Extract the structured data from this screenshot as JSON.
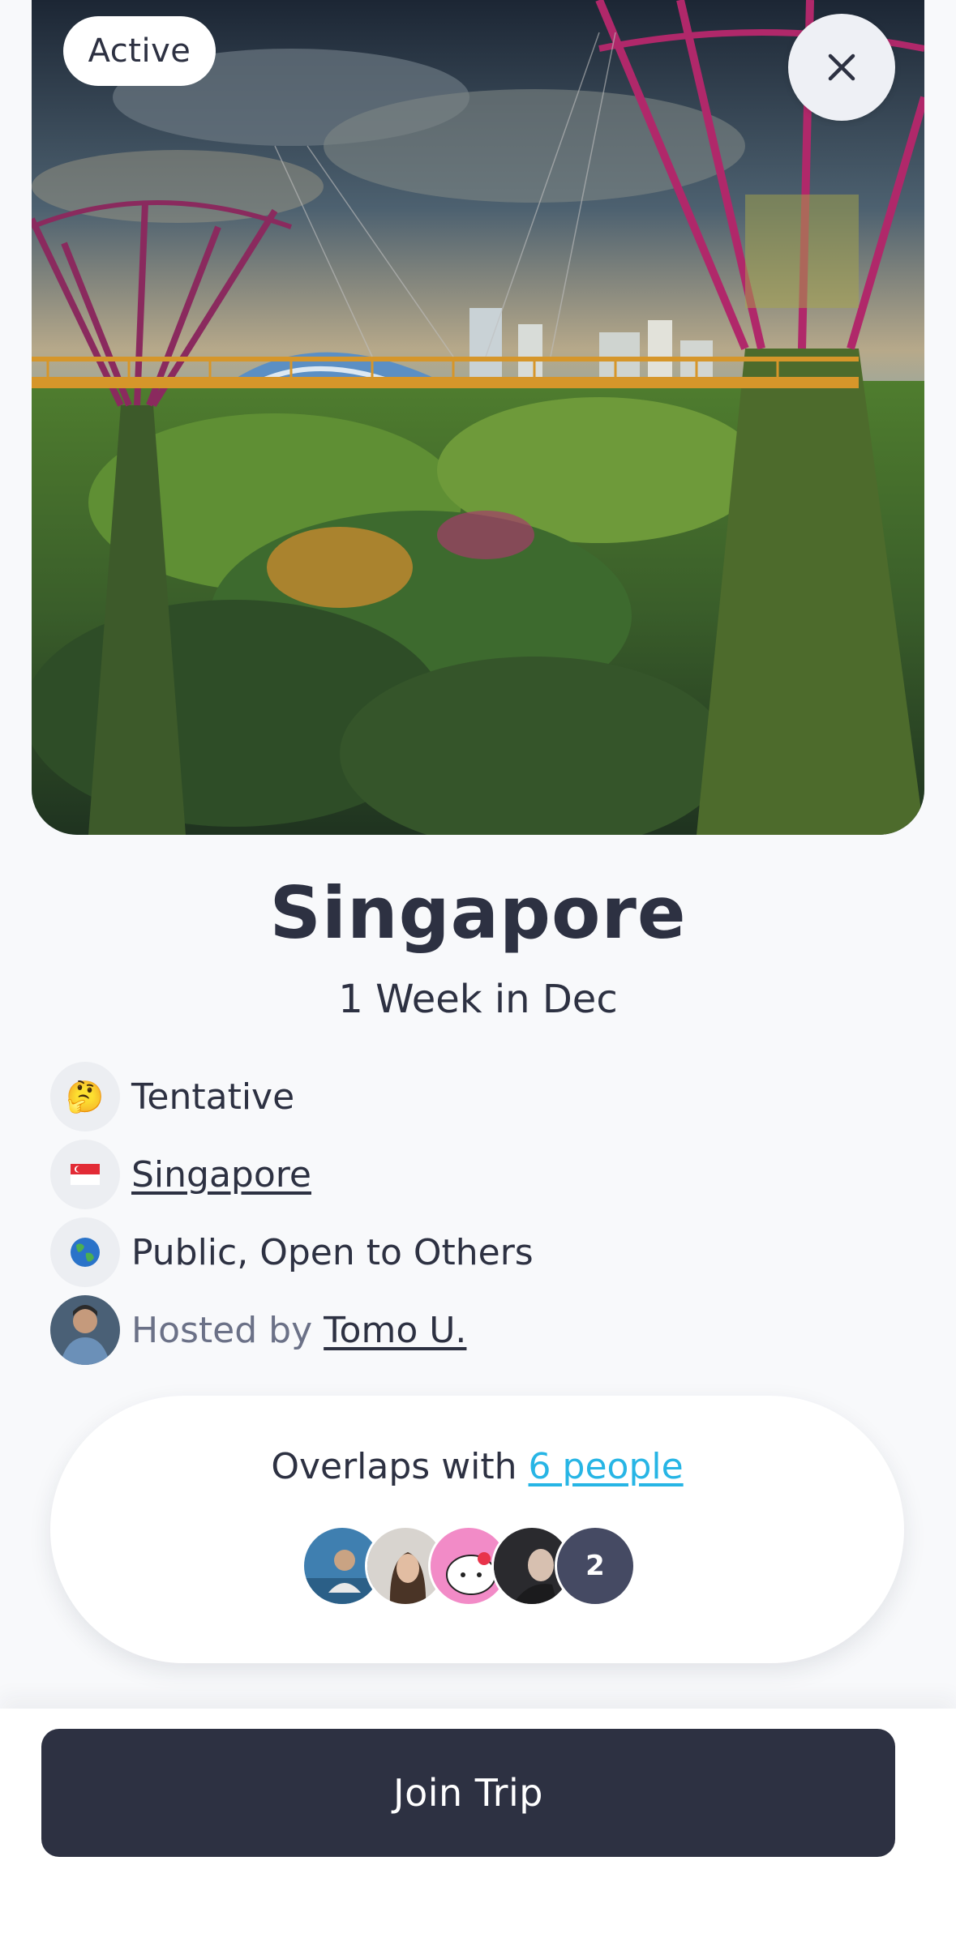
{
  "hero": {
    "status_badge": "Active",
    "close_icon": "close-icon"
  },
  "trip": {
    "title": "Singapore",
    "subtitle": "1 Week in Dec"
  },
  "details": {
    "status": {
      "icon": "🤔",
      "label": "Tentative"
    },
    "location": {
      "icon": "🇸🇬",
      "label": "Singapore"
    },
    "visibility": {
      "icon": "🌎",
      "label": "Public, Open to Others"
    },
    "host": {
      "prefix": "Hosted by",
      "name": "Tomo U."
    }
  },
  "overlaps": {
    "prefix": "Overlaps with",
    "link": "6 people",
    "extra_count": "2"
  },
  "footer": {
    "join_label": "Join Trip"
  },
  "colors": {
    "primary": "#2d3142",
    "link_accent": "#27b5e5",
    "page_bg": "#f8f9fb"
  }
}
